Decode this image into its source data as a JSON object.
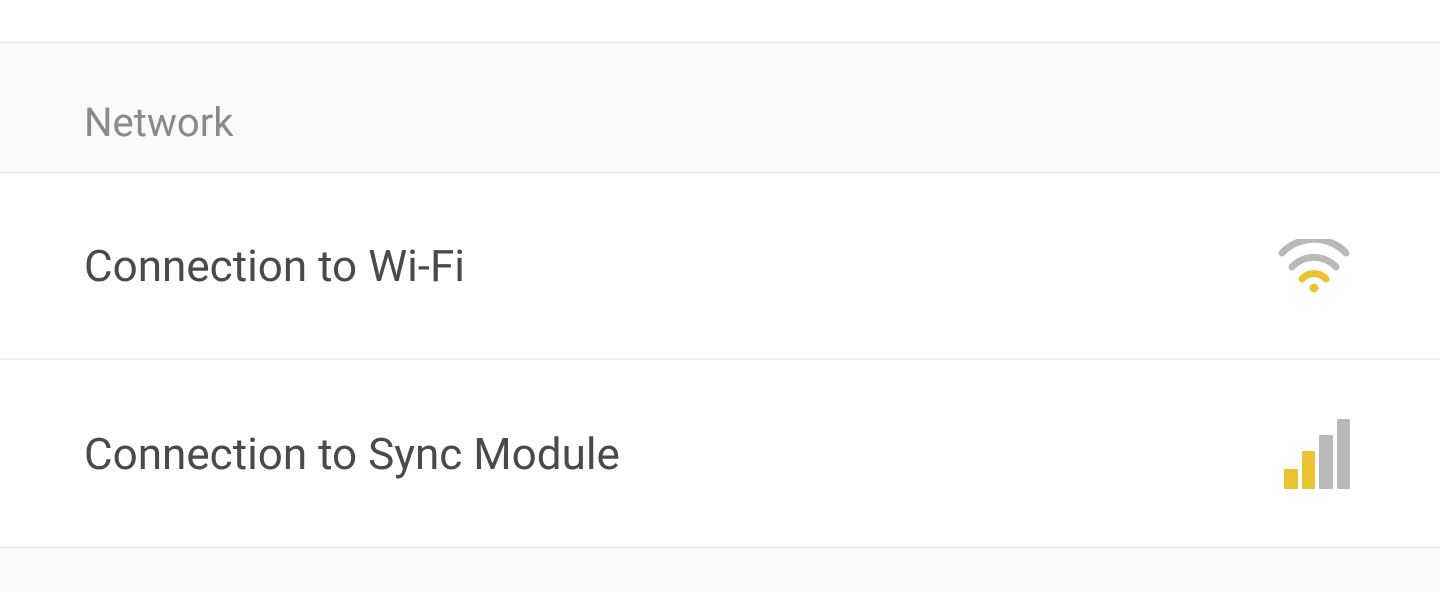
{
  "section": {
    "title": "Network",
    "items": [
      {
        "label": "Connection to Wi-Fi",
        "iconName": "wifi-icon",
        "signalLevel": 1
      },
      {
        "label": "Connection to Sync Module",
        "iconName": "signal-bars-icon",
        "signalLevel": 2
      }
    ]
  },
  "colors": {
    "active": "#ebc331",
    "inactive": "#b9b9b9"
  }
}
